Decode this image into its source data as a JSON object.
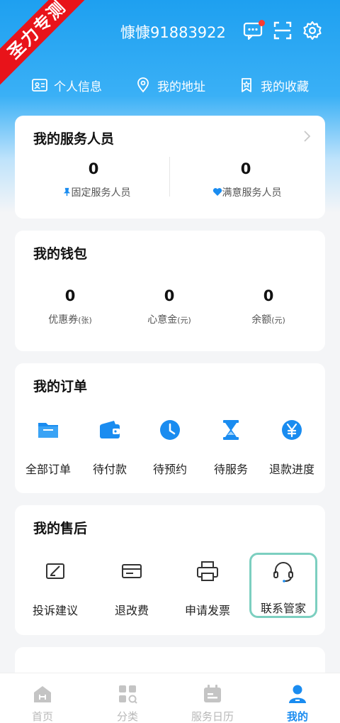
{
  "ribbon": "圣力专测",
  "user": {
    "name": "慷慷91883922"
  },
  "quick_links": [
    {
      "label": "个人信息",
      "icon": "id-card-icon"
    },
    {
      "label": "我的地址",
      "icon": "location-pin-icon"
    },
    {
      "label": "我的收藏",
      "icon": "bookmark-icon"
    }
  ],
  "service_staff": {
    "title": "我的服务人员",
    "fixed": {
      "value": "0",
      "label": "固定服务人员"
    },
    "satisfied": {
      "value": "0",
      "label": "满意服务人员"
    }
  },
  "wallet": {
    "title": "我的钱包",
    "items": [
      {
        "value": "0",
        "label": "优惠券",
        "unit": "(张)"
      },
      {
        "value": "0",
        "label": "心意金",
        "unit": "(元)"
      },
      {
        "value": "0",
        "label": "余额",
        "unit": "(元)"
      }
    ]
  },
  "orders": {
    "title": "我的订单",
    "items": [
      {
        "label": "全部订单",
        "icon": "folder-icon"
      },
      {
        "label": "待付款",
        "icon": "wallet-icon"
      },
      {
        "label": "待预约",
        "icon": "clock-icon"
      },
      {
        "label": "待服务",
        "icon": "hourglass-icon"
      },
      {
        "label": "退款进度",
        "icon": "yen-icon"
      }
    ]
  },
  "after_sales": {
    "title": "我的售后",
    "items": [
      {
        "label": "投诉建议",
        "icon": "edit-note-icon"
      },
      {
        "label": "退改费",
        "icon": "card-icon"
      },
      {
        "label": "申请发票",
        "icon": "printer-icon"
      },
      {
        "label": "联系管家",
        "icon": "headset-icon"
      }
    ]
  },
  "tabs": [
    {
      "label": "首页",
      "icon": "home-icon"
    },
    {
      "label": "分类",
      "icon": "category-icon"
    },
    {
      "label": "服务日历",
      "icon": "calendar-icon"
    },
    {
      "label": "我的",
      "icon": "profile-icon",
      "active": true
    }
  ],
  "colors": {
    "primary": "#1a8cf0",
    "header": "#1ea0f0",
    "ribbon": "#e8131a",
    "highlight_border": "#7ccfc0"
  }
}
